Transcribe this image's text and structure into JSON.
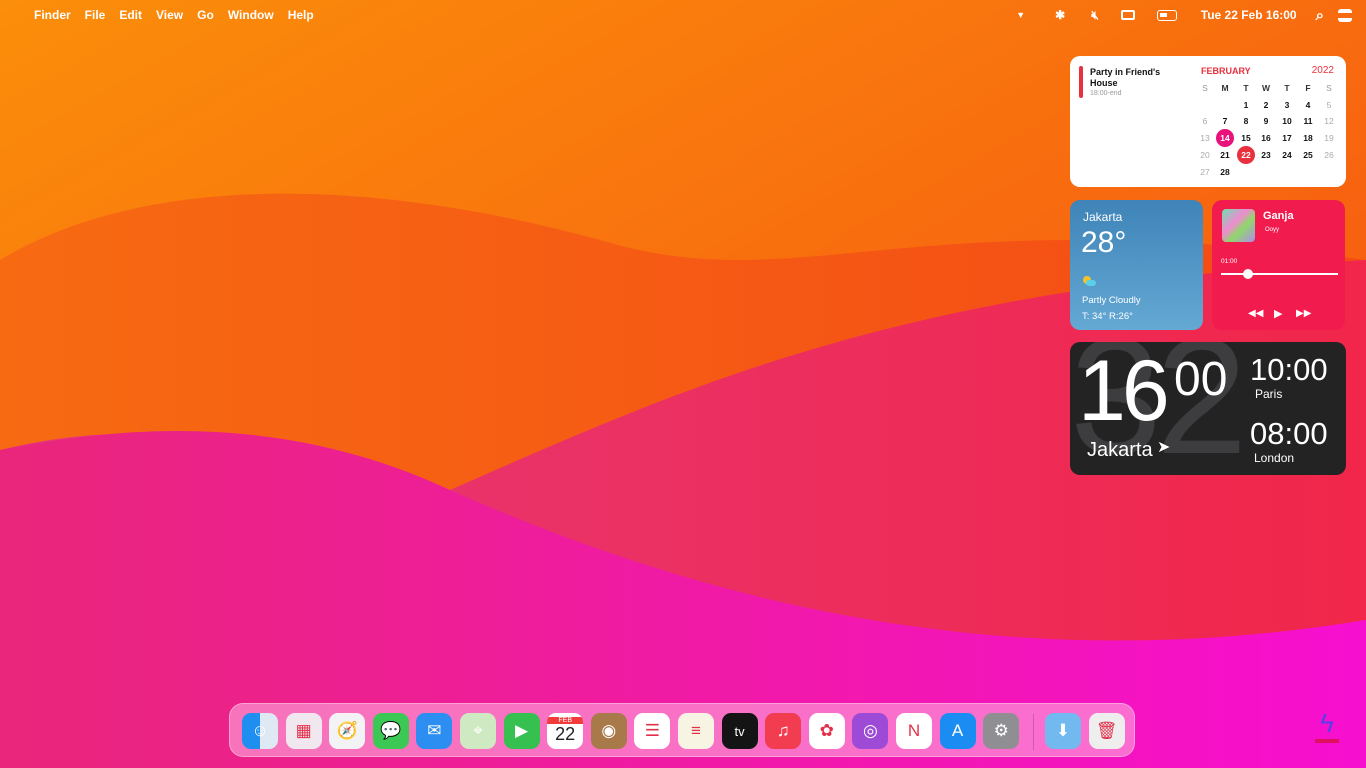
{
  "menubar": {
    "apple_icon": "apple-icon",
    "items": [
      "Finder",
      "File",
      "Edit",
      "View",
      "Go",
      "Window",
      "Help"
    ],
    "datetime": "Tue 22 Feb 16:00",
    "status_icons": [
      "dropdown-icon",
      "bluetooth-icon",
      "volume-muted-icon",
      "display-icon",
      "battery-icon",
      "search-icon",
      "control-center-icon"
    ]
  },
  "calendar": {
    "event_title": "Party in Friend's House",
    "event_time": "18:00-end",
    "month": "FEBRUARY",
    "year": "2022",
    "weekdays": [
      "S",
      "M",
      "T",
      "W",
      "T",
      "F",
      "S"
    ],
    "weeks": [
      [
        "",
        "",
        "1",
        "2",
        "3",
        "4",
        "5"
      ],
      [
        "6",
        "7",
        "8",
        "9",
        "10",
        "11",
        "12"
      ],
      [
        "13",
        "14",
        "15",
        "16",
        "17",
        "18",
        "19"
      ],
      [
        "20",
        "21",
        "22",
        "23",
        "24",
        "25",
        "26"
      ],
      [
        "27",
        "28",
        "",
        "",
        "",
        "",
        ""
      ]
    ],
    "selected": "14",
    "today": "22",
    "accent": "#e8303e"
  },
  "weather": {
    "city": "Jakarta",
    "temp": "28°",
    "condition": "Partly Cloudly",
    "range": "T: 34° R:26°",
    "icon": "partly-cloudy-icon"
  },
  "music": {
    "title": "Ganja",
    "artist": "Ooyy",
    "elapsed": "01:00",
    "progress": 0.23
  },
  "clock": {
    "hour": "16",
    "minute": "00",
    "city": "Jakarta",
    "bg_digits": "32",
    "zones": [
      {
        "time": "10:00",
        "city": "Paris"
      },
      {
        "time": "08:00",
        "city": "London"
      }
    ]
  },
  "dock": {
    "apps": [
      {
        "name": "finder",
        "bg": "linear-gradient(90deg,#1e8ff0 50%,#dfe9f4 50%)",
        "g": "☺"
      },
      {
        "name": "launchpad",
        "bg": "#f1e7ef",
        "g": "▦"
      },
      {
        "name": "safari",
        "bg": "#f3f3f6",
        "g": "🧭"
      },
      {
        "name": "messages",
        "bg": "#3cc854",
        "g": "💬"
      },
      {
        "name": "mail",
        "bg": "#2b8ef0",
        "g": "✉"
      },
      {
        "name": "maps",
        "bg": "#cfe9c3",
        "g": "⌖"
      },
      {
        "name": "facetime",
        "bg": "#35c04f",
        "g": "▶"
      },
      {
        "name": "calendar",
        "bg": "#fff",
        "g": "22",
        "label": "FEB"
      },
      {
        "name": "contacts",
        "bg": "#a87a4a",
        "g": "◉"
      },
      {
        "name": "reminders",
        "bg": "#fff",
        "g": "☰"
      },
      {
        "name": "notes",
        "bg": "#f8f4e4",
        "g": "≡"
      },
      {
        "name": "tv",
        "bg": "#141414",
        "g": "tv"
      },
      {
        "name": "music",
        "bg": "#f23c4f",
        "g": "♫"
      },
      {
        "name": "photos",
        "bg": "#fff",
        "g": "✿"
      },
      {
        "name": "podcasts",
        "bg": "#9d4bd6",
        "g": "◎"
      },
      {
        "name": "news",
        "bg": "#fff",
        "g": "N"
      },
      {
        "name": "app-store",
        "bg": "#1b8cf2",
        "g": "A"
      },
      {
        "name": "system-preferences",
        "bg": "#8e8e93",
        "g": "⚙"
      },
      {
        "name": "downloads",
        "bg": "#71b9ee",
        "g": "⬇"
      },
      {
        "name": "trash",
        "bg": "#eee",
        "g": "🗑"
      }
    ]
  }
}
